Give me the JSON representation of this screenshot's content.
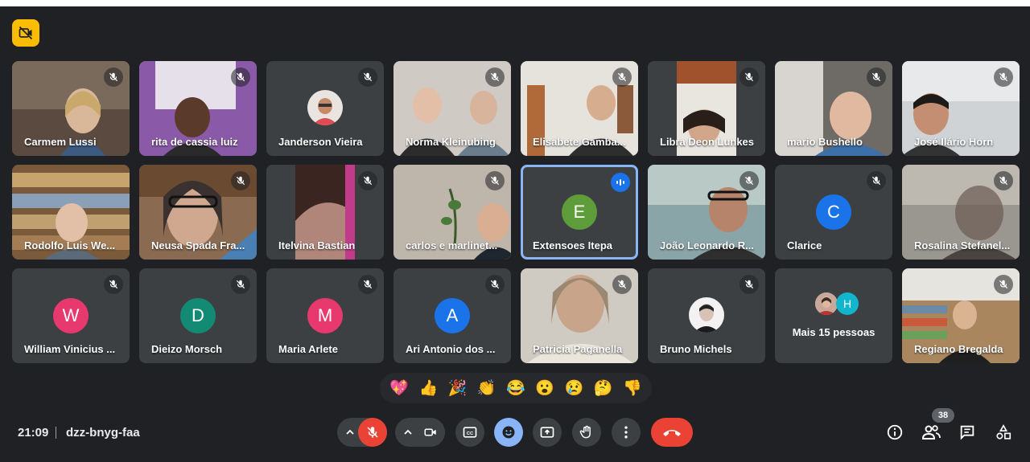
{
  "colors": {
    "background": "#202124",
    "tile": "#3c4043",
    "accent_blue": "#8ab4f8",
    "hangup_red": "#ea4335",
    "badge_yellow": "#fbbc04"
  },
  "top_left_badge": {
    "icon": "camera-off-icon"
  },
  "participants": [
    {
      "name": "Carmem Lussi",
      "muted": true,
      "tile": "video"
    },
    {
      "name": "rita de cassia luiz",
      "muted": true,
      "tile": "video"
    },
    {
      "name": "Janderson Vieira",
      "muted": true,
      "tile": "photo-avatar"
    },
    {
      "name": "Norma Kleinubing",
      "muted": true,
      "tile": "video"
    },
    {
      "name": "Elisabete Gamba...",
      "muted": true,
      "tile": "video"
    },
    {
      "name": "Libra Deon Lunkes",
      "muted": true,
      "tile": "video"
    },
    {
      "name": "mario Bushello",
      "muted": true,
      "tile": "video"
    },
    {
      "name": "José Ilário Horn",
      "muted": true,
      "tile": "video"
    },
    {
      "name": "Rodolfo Luis We...",
      "muted": false,
      "tile": "video"
    },
    {
      "name": "Neusa Spada Fra...",
      "muted": true,
      "tile": "video"
    },
    {
      "name": "Itelvina Bastian",
      "muted": true,
      "tile": "video"
    },
    {
      "name": "carlos e marlinet...",
      "muted": true,
      "tile": "video"
    },
    {
      "name": "Extensoes Itepa",
      "muted": false,
      "speaking": true,
      "tile": "initial",
      "initial": "E",
      "color": "#5f9d3a"
    },
    {
      "name": "João Leonardo R...",
      "muted": true,
      "tile": "video"
    },
    {
      "name": "Clarice",
      "muted": true,
      "tile": "initial",
      "initial": "C",
      "color": "#1a73e8"
    },
    {
      "name": "Rosalina Stefanel...",
      "muted": true,
      "tile": "video"
    },
    {
      "name": "William Vinicius ...",
      "muted": true,
      "tile": "initial",
      "initial": "W",
      "color": "#e8396f"
    },
    {
      "name": "Dieizo Morsch",
      "muted": true,
      "tile": "initial",
      "initial": "D",
      "color": "#128a74"
    },
    {
      "name": "Maria Arlete",
      "muted": true,
      "tile": "initial",
      "initial": "M",
      "color": "#e8396f"
    },
    {
      "name": "Ari Antonio dos ...",
      "muted": true,
      "tile": "initial",
      "initial": "A",
      "color": "#1a73e8"
    },
    {
      "name": "Patricia Paganella",
      "muted": true,
      "tile": "video"
    },
    {
      "name": "Bruno Michels",
      "muted": true,
      "tile": "photo-avatar"
    },
    {
      "name": "Regiano Bregalda",
      "muted": true,
      "tile": "video"
    }
  ],
  "more_tile": {
    "label": "Mais 15 pessoas",
    "avatar_initial": "H"
  },
  "reactions": [
    "💖",
    "👍",
    "🎉",
    "👏",
    "😂",
    "😮",
    "😢",
    "🤔",
    "👎"
  ],
  "bottom_bar": {
    "time": "21:09",
    "meeting_code": "dzz-bnyg-faa",
    "participant_count": "38",
    "controls": [
      "chevron-up-icon",
      "mic-off-icon",
      "chevron-up-icon",
      "camera-icon",
      "captions-icon",
      "emoji-icon",
      "present-icon",
      "raise-hand-icon",
      "more-icon",
      "hangup-icon"
    ],
    "right_icons": [
      "info-icon",
      "people-icon",
      "chat-icon",
      "activities-icon"
    ]
  }
}
